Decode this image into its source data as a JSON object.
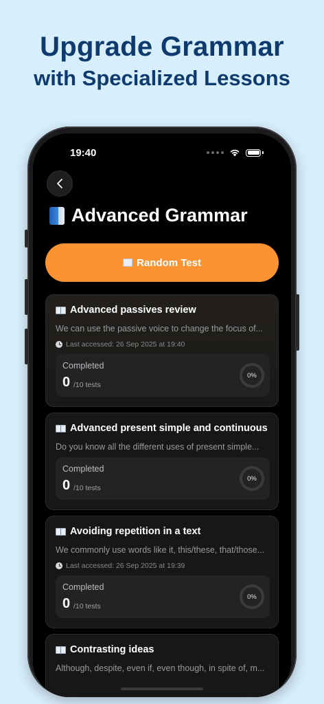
{
  "promo": {
    "line1": "Upgrade Grammar",
    "line2": "with Specialized Lessons"
  },
  "status": {
    "time": "19:40"
  },
  "header": {
    "title": "Advanced Grammar",
    "title_icon": "blue-book-icon"
  },
  "random_test": {
    "label": "Random Test",
    "icon": "card-icon"
  },
  "lessons": [
    {
      "title": "Advanced passives review",
      "description": "We can use the passive voice to change the focus of...",
      "last_accessed": "Last accessed: 26 Sep 2025 at 19:40",
      "completed_label": "Completed",
      "completed": "0",
      "total": "/10 tests",
      "percent": "0%"
    },
    {
      "title": "Advanced present simple and continuous",
      "description": "Do you know all the different uses of present simple...",
      "last_accessed": "",
      "completed_label": "Completed",
      "completed": "0",
      "total": "/10 tests",
      "percent": "0%"
    },
    {
      "title": "Avoiding repetition in a text",
      "description": "We commonly use words like it, this/these, that/those...",
      "last_accessed": "Last accessed: 26 Sep 2025 at 19:39",
      "completed_label": "Completed",
      "completed": "0",
      "total": "/10 tests",
      "percent": "0%"
    },
    {
      "title": "Contrasting ideas",
      "description": "Although, despite, even if, even though, in spite of, m..."
    }
  ],
  "colors": {
    "accent": "#fb9332",
    "background": "#d7eefc",
    "promo_text": "#0e3a6e"
  }
}
